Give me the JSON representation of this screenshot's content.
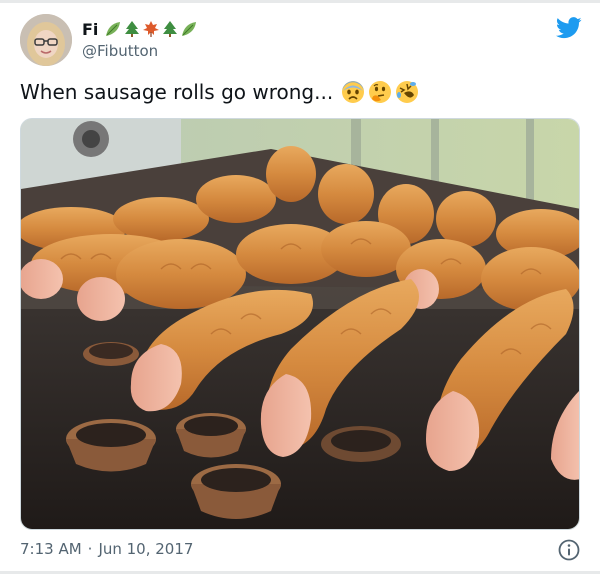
{
  "author": {
    "display_name": "Fi",
    "handle": "@Fibutton",
    "name_emojis": [
      "leaf-icon",
      "tree-icon",
      "maple-leaf-icon",
      "tree-icon",
      "leaf-icon"
    ]
  },
  "tweet": {
    "text": "When sausage rolls go wrong...",
    "text_emojis": [
      "fearful-face-emoji",
      "thinking-face-emoji",
      "rolling-laughing-emoji"
    ],
    "image_description_icon": "sausage-rolls-photo"
  },
  "meta": {
    "time": "7:13 AM",
    "separator": "·",
    "date": "Jun 10, 2017"
  },
  "icons": {
    "brand": "twitter-bird-icon",
    "info": "info-circle-icon"
  },
  "colors": {
    "twitter_blue": "#1d9bf0",
    "text_primary": "#0f1419",
    "text_secondary": "#536471"
  }
}
